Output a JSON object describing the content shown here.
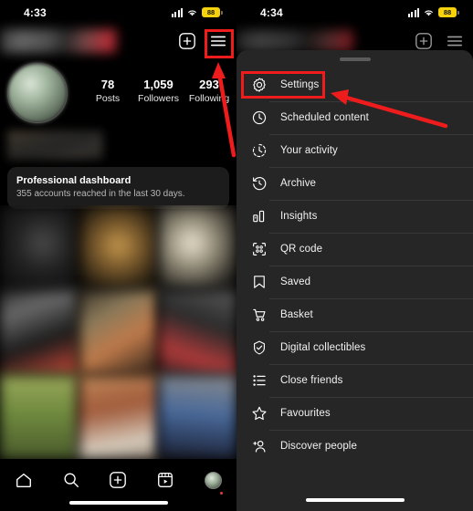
{
  "left_phone": {
    "status_bar": {
      "time": "4:33",
      "battery_level": "88",
      "signal_icon": "cellular-signal-icon",
      "wifi_icon": "wifi-icon",
      "battery_color": "#F5D20C"
    },
    "header": {
      "username_hidden": "",
      "add_button_icon": "plus-box-icon",
      "menu_button_icon": "hamburger-menu-icon"
    },
    "stats": [
      {
        "value": "78",
        "label": "Posts"
      },
      {
        "value": "1,059",
        "label": "Followers"
      },
      {
        "value": "293",
        "label": "Following"
      }
    ],
    "dashboard": {
      "title": "Professional dashboard",
      "subtitle": "355 accounts reached in the last 30 days."
    },
    "grid": {
      "cell_count": 9,
      "cells": [
        "#1a1a1a",
        "#262018",
        "#0f0f0f",
        "#1b1b1b",
        "#2b2620",
        "#141414",
        "#6f7a46",
        "#8a4a38",
        "#2c3b5a"
      ]
    },
    "bottom_nav": [
      {
        "icon": "home-icon",
        "label": "Home"
      },
      {
        "icon": "search-icon",
        "label": "Search"
      },
      {
        "icon": "create-plus-icon",
        "label": "Create"
      },
      {
        "icon": "reels-icon",
        "label": "Reels"
      },
      {
        "icon": "profile-avatar-icon",
        "label": "Profile"
      }
    ]
  },
  "right_phone": {
    "status_bar": {
      "time": "4:34",
      "battery_level": "88",
      "signal_icon": "cellular-signal-icon",
      "wifi_icon": "wifi-icon",
      "battery_color": "#F5D20C"
    },
    "header": {
      "add_button_icon": "plus-box-icon",
      "menu_button_icon": "hamburger-menu-icon"
    },
    "sheet": {
      "handle_icon": "drag-handle-icon",
      "background": "#262626",
      "items": [
        {
          "icon": "settings-gear-icon",
          "label": "Settings"
        },
        {
          "icon": "scheduled-content-clock-icon",
          "label": "Scheduled content"
        },
        {
          "icon": "your-activity-icon",
          "label": "Your activity"
        },
        {
          "icon": "archive-icon",
          "label": "Archive"
        },
        {
          "icon": "insights-bar-chart-icon",
          "label": "Insights"
        },
        {
          "icon": "qr-code-icon",
          "label": "QR code"
        },
        {
          "icon": "saved-bookmark-icon",
          "label": "Saved"
        },
        {
          "icon": "basket-cart-icon",
          "label": "Basket"
        },
        {
          "icon": "digital-collectibles-badge-icon",
          "label": "Digital collectibles"
        },
        {
          "icon": "close-friends-list-icon",
          "label": "Close friends"
        },
        {
          "icon": "favourites-star-icon",
          "label": "Favourites"
        },
        {
          "icon": "discover-people-add-user-icon",
          "label": "Discover people"
        }
      ]
    }
  },
  "annotations": {
    "color": "#EE1C1C",
    "highlight_menu_button": "hamburger-menu-button",
    "highlight_settings_item": "Settings",
    "arrow_left": "arrow-pointing-to-hamburger-menu",
    "arrow_right": "arrow-pointing-to-settings"
  }
}
